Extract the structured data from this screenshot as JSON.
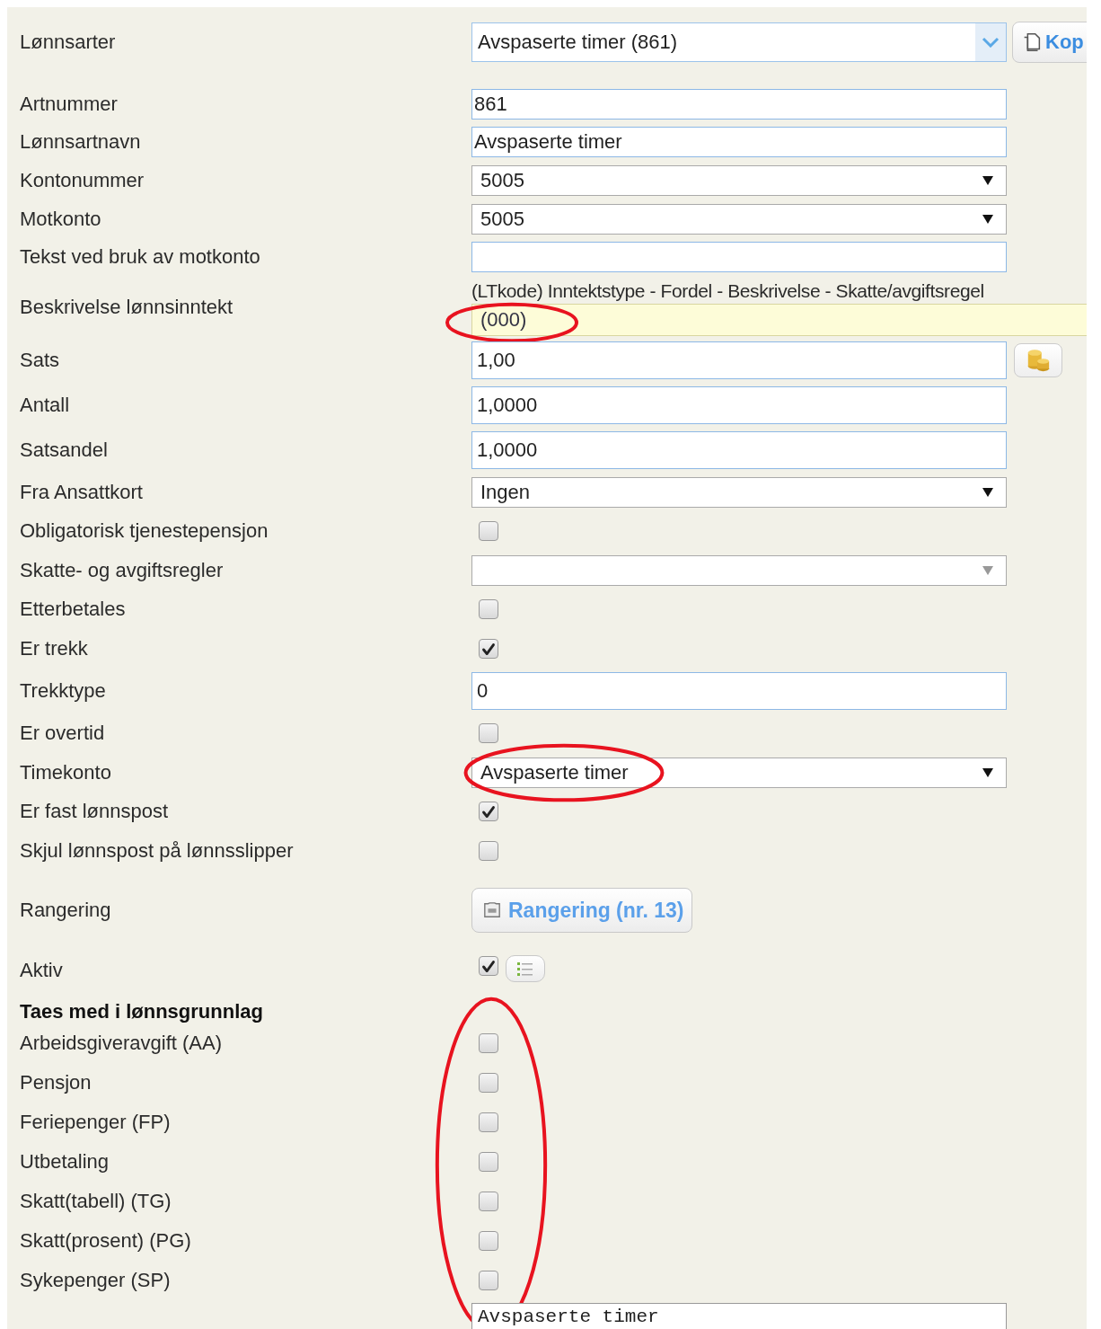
{
  "rows": [
    {
      "kind": "combo",
      "label": "Lønnsarter",
      "value": "Avspaserte timer (861)",
      "copy_button": "Kop"
    },
    {
      "kind": "text",
      "label": "Artnummer",
      "value": "861"
    },
    {
      "kind": "text",
      "label": "Lønnsartnavn",
      "value": "Avspaserte timer"
    },
    {
      "kind": "select",
      "label": "Kontonummer",
      "value": "5005"
    },
    {
      "kind": "select",
      "label": "Motkonto",
      "value": "5005"
    },
    {
      "kind": "text",
      "label": "Tekst ved bruk av motkonto",
      "value": ""
    },
    {
      "kind": "info",
      "label": "Beskrivelse lønnsinntekt",
      "header": "(LTkode) Inntektstype - Fordel - Beskrivelse - Skatte/avgiftsregel",
      "value": "(000)",
      "circled": true
    },
    {
      "kind": "amount",
      "label": "Sats",
      "value": "1,00",
      "coin_button": true
    },
    {
      "kind": "amount",
      "label": "Antall",
      "value": "1,0000"
    },
    {
      "kind": "amount",
      "label": "Satsandel",
      "value": "1,0000"
    },
    {
      "kind": "select",
      "label": "Fra Ansattkort",
      "value": "Ingen"
    },
    {
      "kind": "checkbox",
      "label": "Obligatorisk tjenestepensjon",
      "checked": false
    },
    {
      "kind": "select",
      "label": "Skatte- og avgiftsregler",
      "value": ""
    },
    {
      "kind": "checkbox",
      "label": "Etterbetales",
      "checked": false
    },
    {
      "kind": "checkbox",
      "label": "Er trekk",
      "checked": true
    },
    {
      "kind": "amount",
      "label": "Trekktype",
      "value": "0"
    },
    {
      "kind": "checkbox",
      "label": "Er overtid",
      "checked": false
    },
    {
      "kind": "select",
      "label": "Timekonto",
      "value": "Avspaserte timer",
      "circled": true
    },
    {
      "kind": "checkbox",
      "label": "Er fast lønnspost",
      "checked": true
    },
    {
      "kind": "checkbox",
      "label": "Skjul lønnspost på lønnsslipper",
      "checked": false
    },
    {
      "kind": "button",
      "label": "Rangering",
      "button": "Rangering (nr. 13)"
    },
    {
      "kind": "active",
      "label": "Aktiv",
      "checked": true
    }
  ],
  "basis_group": {
    "title": "Taes med i lønnsgrunnlag",
    "circled": true,
    "items": [
      {
        "label": "Arbeidsgiveravgift (AA)",
        "checked": false
      },
      {
        "label": "Pensjon",
        "checked": false
      },
      {
        "label": "Feriepenger (FP)",
        "checked": false
      },
      {
        "label": "Utbetaling",
        "checked": false
      },
      {
        "label": "Skatt(tabell) (TG)",
        "checked": false
      },
      {
        "label": "Skatt(prosent) (PG)",
        "checked": false
      },
      {
        "label": "Sykepenger (SP)",
        "checked": false
      }
    ]
  },
  "note_field": {
    "value": "Avspaserte timer"
  }
}
